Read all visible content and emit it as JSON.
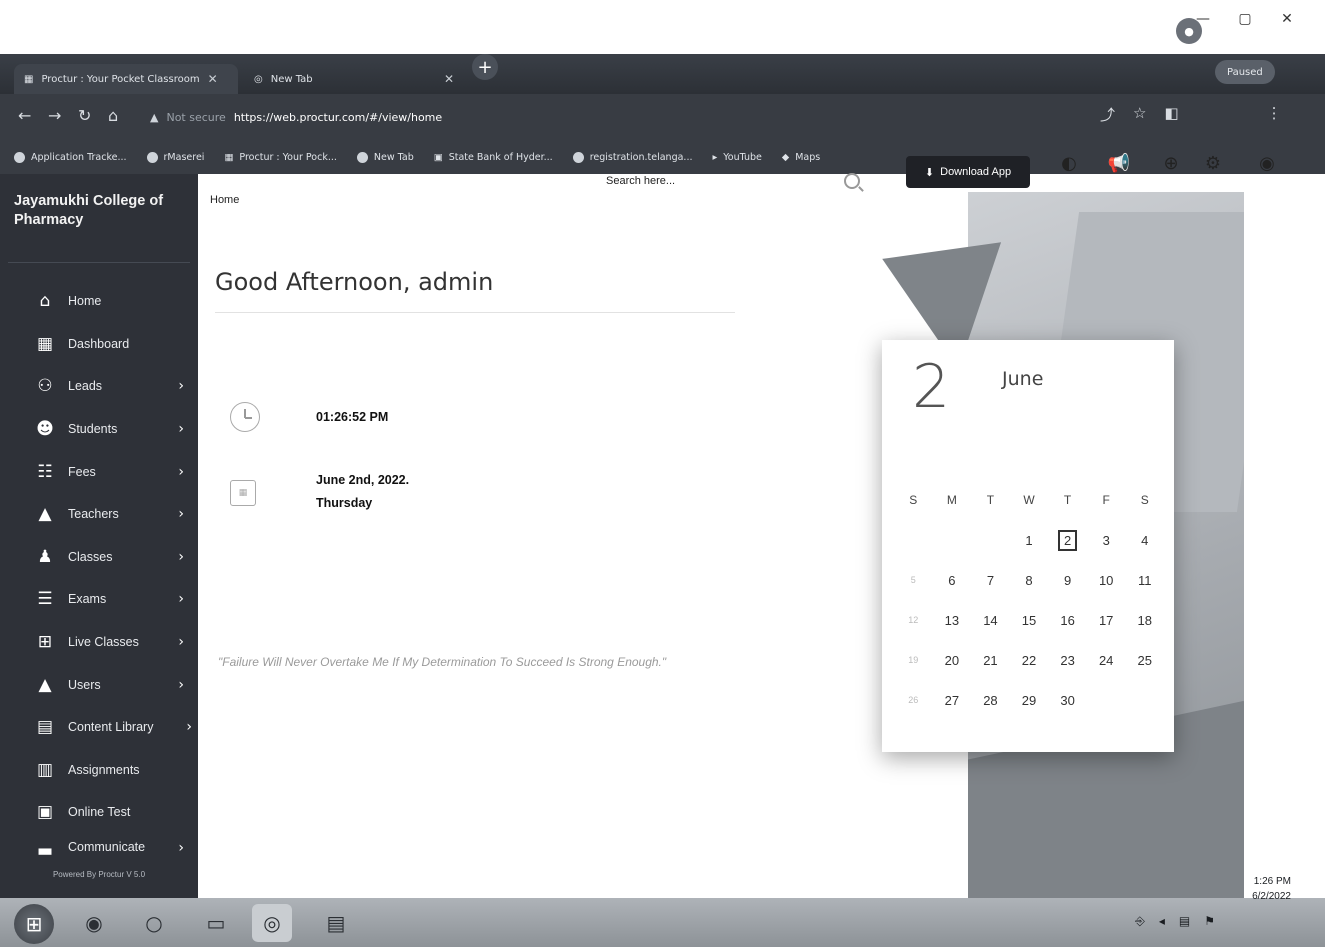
{
  "browser": {
    "tabs": [
      {
        "title": "Proctur : Your Pocket Classroom",
        "active": true
      },
      {
        "title": "New Tab",
        "active": false
      }
    ],
    "new_tab_symbol": "+",
    "address": {
      "security": "Not secure",
      "url": "https://web.proctur.com/#/view/home"
    },
    "profile_chip": "Paused",
    "bookmarks": [
      "Application Tracke...",
      "rMaserei",
      "Proctur : Your Pock...",
      "New Tab",
      "State Bank of Hyder...",
      "registration.telanga...",
      "YouTube",
      "Maps"
    ]
  },
  "header": {
    "search_placeholder": "Search here...",
    "download_app_label": "Download App",
    "icons": [
      "moon-icon",
      "megaphone-icon",
      "add-circle-icon",
      "gear-icon",
      "user-icon"
    ]
  },
  "sidebar": {
    "college_name": "Jayamukhi College of Pharmacy",
    "items": [
      {
        "label": "Home",
        "icon": "home-icon",
        "chevron": false
      },
      {
        "label": "Dashboard",
        "icon": "dashboard-icon",
        "chevron": false
      },
      {
        "label": "Leads",
        "icon": "leads-icon",
        "chevron": true
      },
      {
        "label": "Students",
        "icon": "students-icon",
        "chevron": true
      },
      {
        "label": "Fees",
        "icon": "fees-icon",
        "chevron": true
      },
      {
        "label": "Teachers",
        "icon": "teachers-icon",
        "chevron": true
      },
      {
        "label": "Classes",
        "icon": "classes-icon",
        "chevron": true
      },
      {
        "label": "Exams",
        "icon": "exams-icon",
        "chevron": true
      },
      {
        "label": "Live Classes",
        "icon": "live-classes-icon",
        "chevron": true
      },
      {
        "label": "Users",
        "icon": "users-icon",
        "chevron": true
      },
      {
        "label": "Content Library",
        "icon": "content-library-icon",
        "chevron": true
      },
      {
        "label": "Assignments",
        "icon": "assignments-icon",
        "chevron": false
      },
      {
        "label": "Online Test",
        "icon": "online-test-icon",
        "chevron": false
      },
      {
        "label": "Communicate",
        "icon": "communicate-icon",
        "chevron": true
      }
    ],
    "powered_by": "Powered By Proctur V 5.0"
  },
  "main": {
    "breadcrumb": "Home",
    "greeting": "Good Afternoon, admin",
    "time": "01:26:52 PM",
    "date": "June 2nd, 2022.",
    "weekday": "Thursday",
    "quote": "\"Failure Will Never Overtake Me If My Determination To Succeed Is Strong Enough.\""
  },
  "calendar": {
    "day": "2",
    "month": "June",
    "weekday_headers": [
      "S",
      "M",
      "T",
      "W",
      "T",
      "F",
      "S"
    ],
    "weeks": [
      [
        "",
        "",
        "",
        "1",
        "2",
        "3",
        "4"
      ],
      [
        "5",
        "6",
        "7",
        "8",
        "9",
        "10",
        "11"
      ],
      [
        "12",
        "13",
        "14",
        "15",
        "16",
        "17",
        "18"
      ],
      [
        "19",
        "20",
        "21",
        "22",
        "23",
        "24",
        "25"
      ],
      [
        "26",
        "27",
        "28",
        "29",
        "30",
        "",
        ""
      ]
    ],
    "today": "2"
  },
  "taskbar": {
    "time": "1:26 PM",
    "date": "6/2/2022"
  }
}
